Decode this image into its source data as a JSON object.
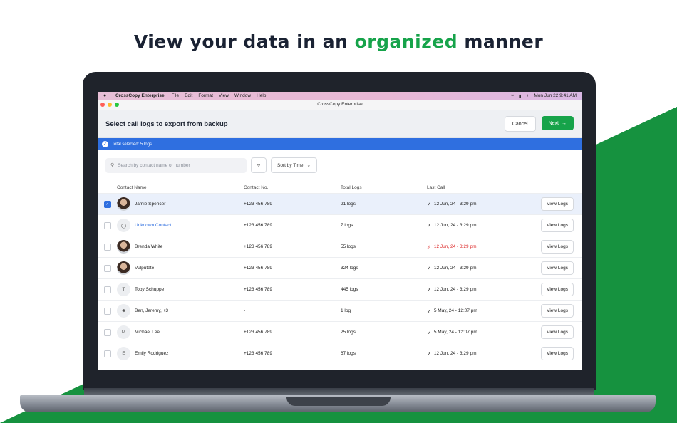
{
  "headline": {
    "prefix": "View your data in an ",
    "accent": "organized",
    "suffix": " manner"
  },
  "colors": {
    "accent": "#16a34a",
    "primary": "#2f6fe0",
    "missed": "#dc2626"
  },
  "menubar": {
    "app": "CrossCopy Enterprise",
    "items": [
      "File",
      "Edit",
      "Format",
      "View",
      "Window",
      "Help"
    ],
    "datetime": "Mon Jun 22  9:41 AM"
  },
  "window": {
    "title": "CrossCopy Enterprise"
  },
  "header": {
    "title": "Select call logs to export from backup",
    "cancel": "Cancel",
    "next": "Next"
  },
  "banner": {
    "text": "Total selected: 5 logs"
  },
  "toolbar": {
    "search_placeholder": "Search by contact name or number",
    "sort": "Sort by Time"
  },
  "table": {
    "columns": [
      "Contact Name",
      "Contact No.",
      "Total Logs",
      "Last Call"
    ],
    "view_label": "View Logs",
    "rows": [
      {
        "name": "Jamie Spencer",
        "avatar": "photo",
        "number": "+123 456 789",
        "logs": "21 logs",
        "last": "12 Jun, 24 - 3:29 pm",
        "call": "outgoing",
        "selected": true
      },
      {
        "name": "Unknown Contact",
        "avatar": "person-icon",
        "number": "+123 456 789",
        "logs": "7 logs",
        "last": "12 Jun, 24 - 3:29 pm",
        "call": "outgoing",
        "selected": false,
        "link": true
      },
      {
        "name": "Brenda White",
        "avatar": "photo",
        "number": "+123 456 789",
        "logs": "55 logs",
        "last": "12 Jun, 24 - 3:29 pm",
        "call": "missed",
        "selected": false
      },
      {
        "name": "Vulputate",
        "avatar": "photo",
        "number": "+123 456 789",
        "logs": "324 logs",
        "last": "12 Jun, 24 - 3:29 pm",
        "call": "outgoing",
        "selected": false
      },
      {
        "name": "Toby Schuppe",
        "avatar": "T",
        "number": "+123 456 789",
        "logs": "445 logs",
        "last": "12 Jun, 24 - 3:29 pm",
        "call": "outgoing",
        "selected": false
      },
      {
        "name": "Ben, Jeremy, +3",
        "avatar": "group-icon",
        "number": "-",
        "logs": "1 log",
        "last": "5 May, 24 - 12:07 pm",
        "call": "incoming",
        "selected": false
      },
      {
        "name": "Michael Lee",
        "avatar": "M",
        "number": "+123 456 789",
        "logs": "25 logs",
        "last": "5 May, 24 - 12:07 pm",
        "call": "incoming",
        "selected": false
      },
      {
        "name": "Emily Rodriguez",
        "avatar": "E",
        "number": "+123 456 789",
        "logs": "67 logs",
        "last": "12 Jun, 24 - 3:29 pm",
        "call": "outgoing",
        "selected": false
      }
    ]
  }
}
